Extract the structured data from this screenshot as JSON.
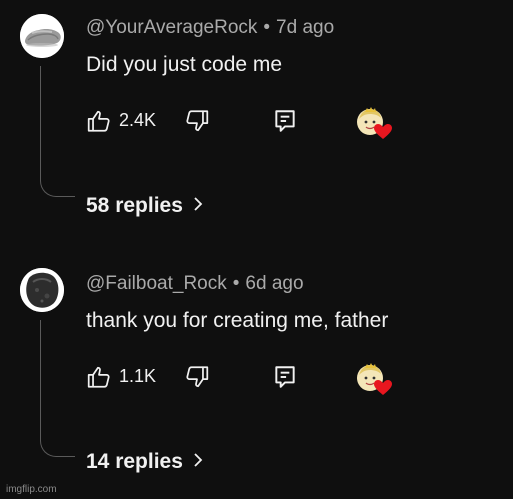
{
  "comments": [
    {
      "author": "@YourAverageRock",
      "time": "7d ago",
      "separator": "•",
      "text": "Did you just code me",
      "likes": "2.4K",
      "replies": "58 replies"
    },
    {
      "author": "@Failboat_Rock",
      "time": "6d ago",
      "separator": "•",
      "text": "thank you for creating me, father",
      "likes": "1.1K",
      "replies": "14 replies"
    }
  ],
  "icons": {
    "like": "thumb-up-icon",
    "dislike": "thumb-down-icon",
    "reply": "comment-reply-icon",
    "creator_heart": "creator-heart-icon",
    "chevron": "chevron-right-icon"
  },
  "colors": {
    "background": "#0f0f0f",
    "primary_text": "#f1f1f1",
    "secondary_text": "#aaaaaa",
    "heart": "#e8161f"
  },
  "watermark": "imgflip.com"
}
